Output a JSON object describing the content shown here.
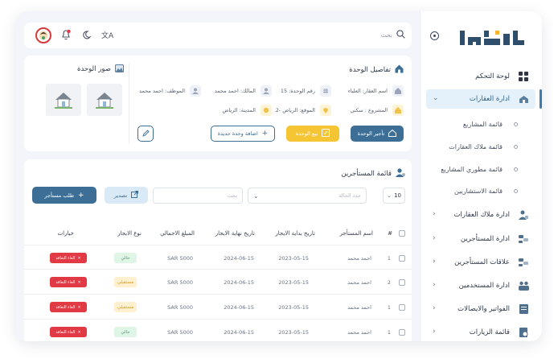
{
  "brand": {
    "logo_text": "املاك",
    "color": "#2e4e6b"
  },
  "topbar": {
    "search_placeholder": "بحث"
  },
  "sidebar": {
    "items": [
      {
        "label": "لوحة التحكم",
        "icon": "dashboard-icon"
      },
      {
        "label": "ادارة العقارات",
        "icon": "building-icon",
        "active": true
      },
      {
        "label": "ادارة ملاك العقارات",
        "icon": "owner-icon"
      },
      {
        "label": "ادارة المستأجرين",
        "icon": "tenants-icon"
      },
      {
        "label": "علاقات المستأجرين",
        "icon": "relations-icon"
      },
      {
        "label": "ادارة المستخدمين",
        "icon": "users-icon"
      },
      {
        "label": "الفواتير والايصالات",
        "icon": "invoice-icon"
      },
      {
        "label": "قائمة الزيارات",
        "icon": "visits-icon"
      }
    ],
    "subitems": [
      "قائمة المشاريع",
      "قائمة ملاك العقارات",
      "قائمة مطوري المشاريع",
      "قائمة الاستشاريين"
    ]
  },
  "unit": {
    "title": "تفاصيل الوحدة",
    "fields": {
      "name": "اسم العقار: العلياء",
      "number": "رقم الوحدة: 15",
      "owner": "المالك: احمد محمد",
      "employee": "الموظف: احمد محمد",
      "project": "المشروع : سكني",
      "location": "الموقع: الرياض -2",
      "city": "المدينة: الرياض"
    },
    "buttons": {
      "rent": "تأجير الوحدة",
      "sell": "بيع الوحدة",
      "add": "اضافة وحدة جديدة"
    }
  },
  "images": {
    "title": "صور الوحدة"
  },
  "tenants": {
    "title": "قائمة المستأجرين",
    "page_size": "10",
    "status_placeholder": "حدد الحالة",
    "search_placeholder": "بحث",
    "export_label": "تصدير",
    "request_label": "طلب مستأجر",
    "columns": [
      "#",
      "اسم المستأجر",
      "تاريخ بداية الايجار",
      "تاريخ نهاية الايجار",
      "المبلغ الاجمالي",
      "نوع الايجار",
      "خيارات"
    ],
    "rows": [
      {
        "num": "1",
        "name": "احمد محمد",
        "start": "2023-05-15",
        "end": "2024-06-15",
        "amount": "SAR 5000",
        "type": "حالي",
        "type_color": "green",
        "action": "الغاء التعاقد"
      },
      {
        "num": "2",
        "name": "احمد محمد",
        "start": "2023-05-15",
        "end": "2024-06-15",
        "amount": "SAR 5000",
        "type": "مستقبلي",
        "type_color": "yellow",
        "action": "الغاء التعاقد"
      },
      {
        "num": "1",
        "name": "احمد محمد",
        "start": "2023-05-15",
        "end": "2024-06-15",
        "amount": "SAR 5000",
        "type": "مستقبلي",
        "type_color": "yellow",
        "action": "الغاء التعاقد"
      },
      {
        "num": "1",
        "name": "احمد محمد",
        "start": "2023-05-15",
        "end": "2024-06-15",
        "amount": "SAR 5000",
        "type": "حالي",
        "type_color": "green",
        "action": "الغاء التعاقد"
      }
    ]
  },
  "colors": {
    "primary": "#3d6f96",
    "accent": "#f5c533",
    "danger": "#e23a45",
    "success": "#45a36a"
  }
}
